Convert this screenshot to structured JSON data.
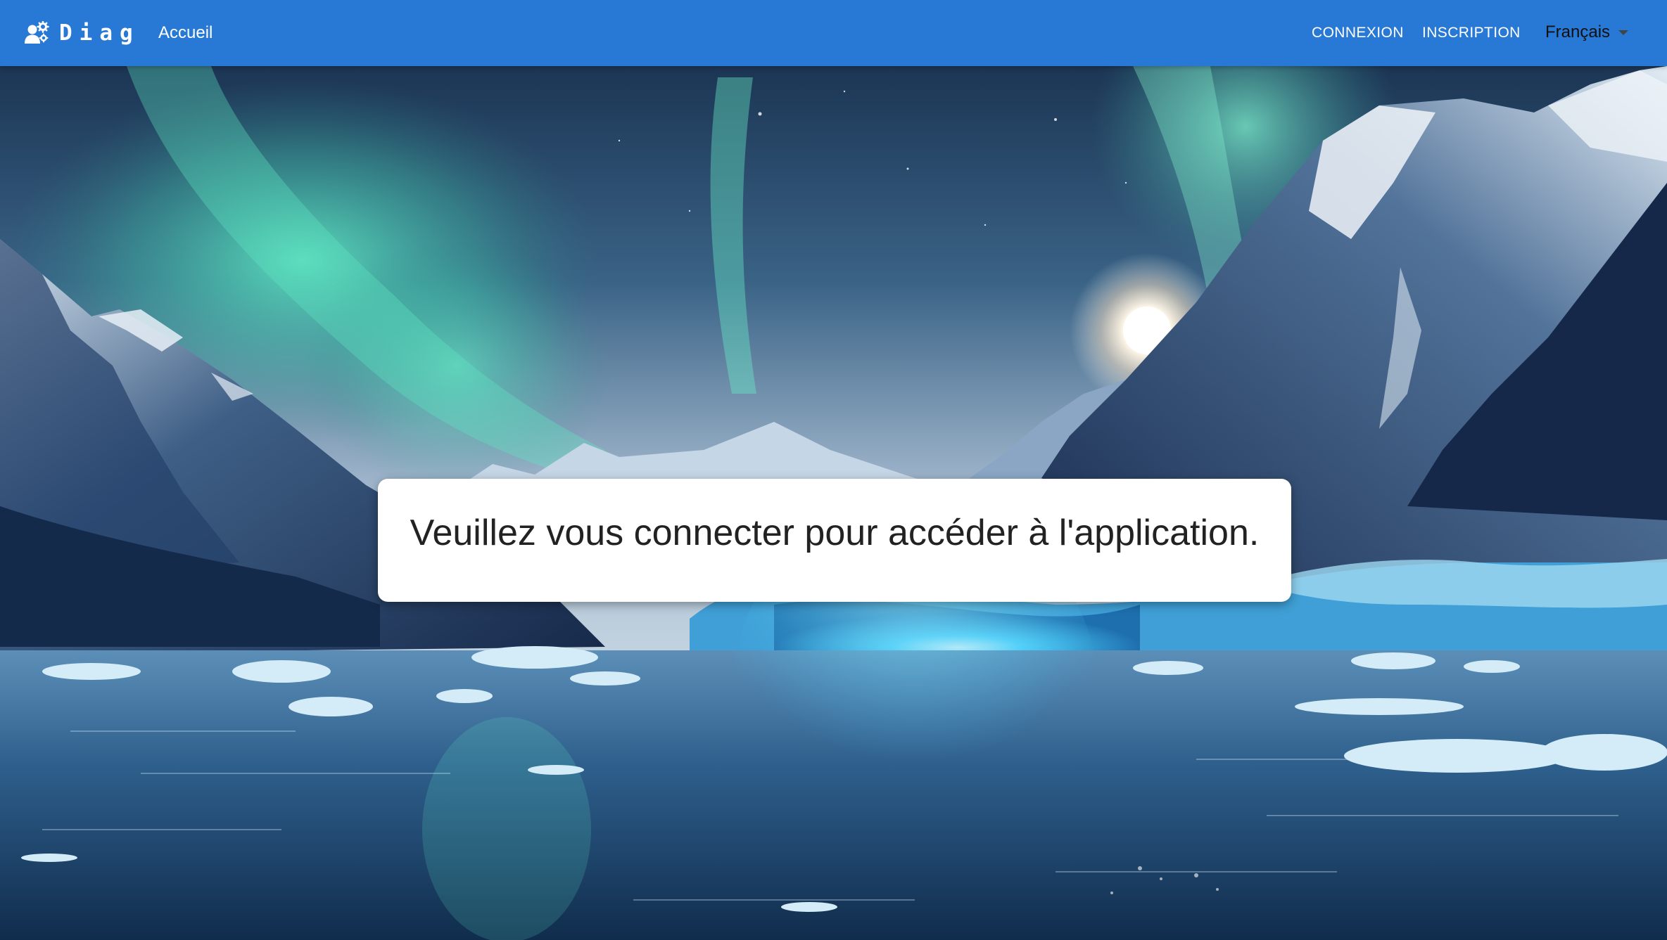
{
  "navbar": {
    "brand": {
      "icon": "users-gear-icon",
      "name": "Diag"
    },
    "home_link": "Accueil",
    "login_link": "CONNEXION",
    "register_link": "INSCRIPTION",
    "language": {
      "selected": "Français",
      "caret_icon": "caret-down-icon"
    },
    "background_color": "#2878d6"
  },
  "main": {
    "message": "Veuillez vous connecter pour accéder à l'application."
  }
}
